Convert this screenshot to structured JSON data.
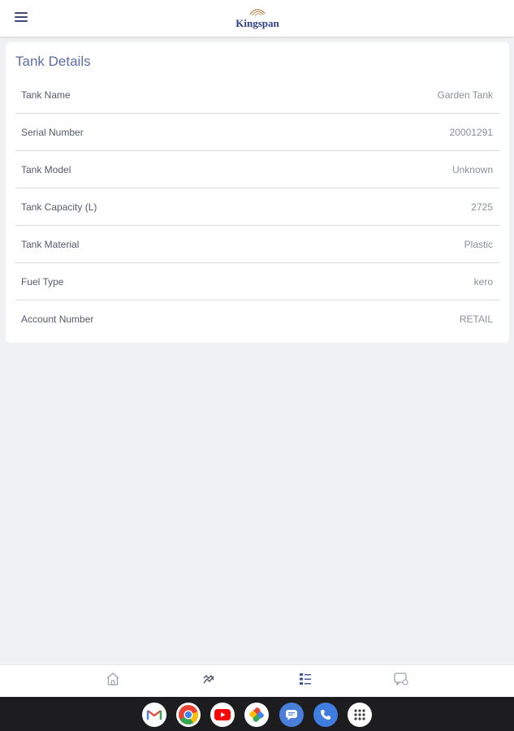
{
  "header": {
    "logo_text": "Kingspan"
  },
  "card": {
    "title": "Tank Details",
    "rows": [
      {
        "label": "Tank Name",
        "value": "Garden Tank"
      },
      {
        "label": "Serial Number",
        "value": "20001291"
      },
      {
        "label": "Tank Model",
        "value": "Unknown"
      },
      {
        "label": "Tank Capacity (L)",
        "value": "2725"
      },
      {
        "label": "Tank Material",
        "value": "Plastic"
      },
      {
        "label": "Fuel Type",
        "value": "kero"
      },
      {
        "label": "Account Number",
        "value": "RETAIL"
      }
    ]
  },
  "bottom_nav": {
    "items": [
      {
        "icon": "home-icon"
      },
      {
        "icon": "trend-icon"
      },
      {
        "icon": "list-icon",
        "active": true
      },
      {
        "icon": "chat-icon"
      }
    ]
  },
  "system_dock": {
    "apps": [
      "gmail-icon",
      "chrome-icon",
      "youtube-icon",
      "photos-icon",
      "messages-icon",
      "phone-icon",
      "app-drawer-icon"
    ]
  },
  "colors": {
    "accent": "#5f6ea8",
    "brand": "#2c3f8c",
    "background": "#eff1f3"
  }
}
